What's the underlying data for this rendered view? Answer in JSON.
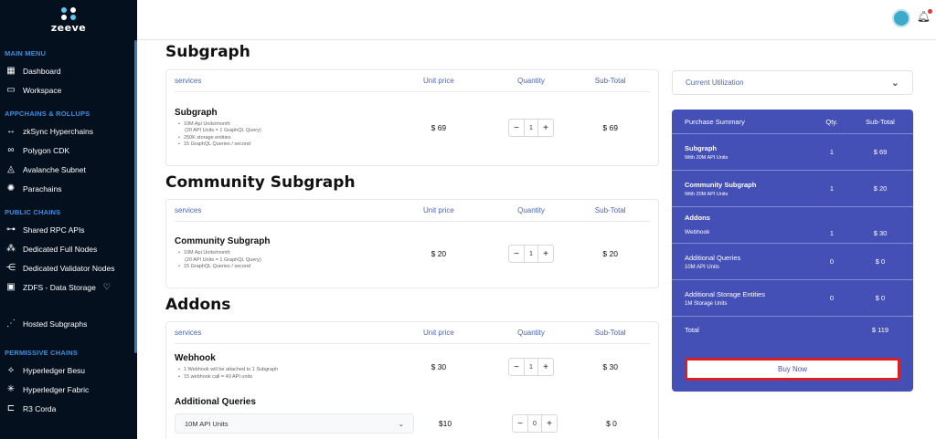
{
  "brand": {
    "name": "zeeve"
  },
  "sidebar": {
    "sections": [
      {
        "title": "MAIN MENU",
        "items": [
          {
            "label": "Dashboard",
            "icon": "grid-icon"
          },
          {
            "label": "Workspace",
            "icon": "terminal-icon"
          }
        ]
      },
      {
        "title": "APPCHAINS & ROLLUPS",
        "items": [
          {
            "label": "zkSync Hyperchains",
            "icon": "arrows-icon"
          },
          {
            "label": "Polygon CDK",
            "icon": "link-icon"
          },
          {
            "label": "Avalanche Subnet",
            "icon": "avalanche-icon"
          },
          {
            "label": "Parachains",
            "icon": "polkadot-icon"
          }
        ]
      },
      {
        "title": "PUBLIC CHAINS",
        "items": [
          {
            "label": "Shared RPC APIs",
            "icon": "rpc-icon"
          },
          {
            "label": "Dedicated Full Nodes",
            "icon": "nodes-icon"
          },
          {
            "label": "Dedicated Validator Nodes",
            "icon": "validator-icon"
          },
          {
            "label": "ZDFS - Data Storage",
            "icon": "storage-icon"
          }
        ]
      },
      {
        "title": "",
        "items": [
          {
            "label": "Hosted Subgraphs",
            "icon": "subgraph-icon"
          }
        ]
      },
      {
        "title": "PERMISSIVE CHAINS",
        "items": [
          {
            "label": "Hyperledger Besu",
            "icon": "besu-icon"
          },
          {
            "label": "Hyperledger Fabric",
            "icon": "fabric-icon"
          },
          {
            "label": "R3 Corda",
            "icon": "corda-icon"
          }
        ]
      }
    ]
  },
  "table_headers": {
    "services": "services",
    "unit_price": "Unit price",
    "quantity": "Quantity",
    "sub_total": "Sub-Total"
  },
  "sections": {
    "subgraph": {
      "title": "Subgraph",
      "row": {
        "name": "Subgraph",
        "desc": [
          "10M Api Units/month",
          "(20 API Units = 1 GraphQL Query)",
          "250K storage entities",
          "15 GraphQL Queries / second"
        ],
        "price": "$ 69",
        "qty": "1",
        "subtotal": "$ 69"
      }
    },
    "community": {
      "title": "Community Subgraph",
      "row": {
        "name": "Community Subgraph",
        "desc": [
          "10M Api Units/month",
          "(20 API Units = 1 GraphQL Query)",
          "15 GraphQL Queries / second"
        ],
        "price": "$ 20",
        "qty": "1",
        "subtotal": "$ 20"
      }
    },
    "addons": {
      "title": "Addons",
      "webhook": {
        "name": "Webhook",
        "desc": [
          "1 Webhook will be attached to 1 Subgraph",
          "15 webhook call = 40 API units"
        ],
        "price": "$ 30",
        "qty": "1",
        "subtotal": "$ 30"
      },
      "queries": {
        "name": "Additional Queries",
        "select": "10M API Units",
        "price": "$10",
        "qty": "0",
        "subtotal": "$ 0"
      }
    }
  },
  "utilization": {
    "label": "Current Utilization"
  },
  "summary": {
    "headers": {
      "title": "Purchase Summary",
      "qty": "Qty.",
      "subtotal": "Sub-Total"
    },
    "rows": [
      {
        "name": "Subgraph",
        "sub": "With 20M API Units",
        "qty": "1",
        "total": "$ 69"
      },
      {
        "name": "Community Subgraph",
        "sub": "With 20M API Units",
        "qty": "1",
        "total": "$ 20"
      }
    ],
    "addons_label": "Addons",
    "addon_rows": [
      {
        "name": "Webhook",
        "qty": "1",
        "total": "$ 30"
      }
    ],
    "extra_rows": [
      {
        "name": "Additional Queries",
        "sub": "10M API Units",
        "qty": "0",
        "total": "$ 0"
      },
      {
        "name": "Additional Storage Entities",
        "sub": "1M Storage Units",
        "qty": "0",
        "total": "$ 0"
      }
    ],
    "total_label": "Total",
    "total_value": "$ 119",
    "buy_label": "Buy Now"
  },
  "colors": {
    "sidebar_bg": "#04101d",
    "accent": "#4550b6",
    "section_title": "#3d8fe0",
    "buy_border": "#d61f26"
  }
}
